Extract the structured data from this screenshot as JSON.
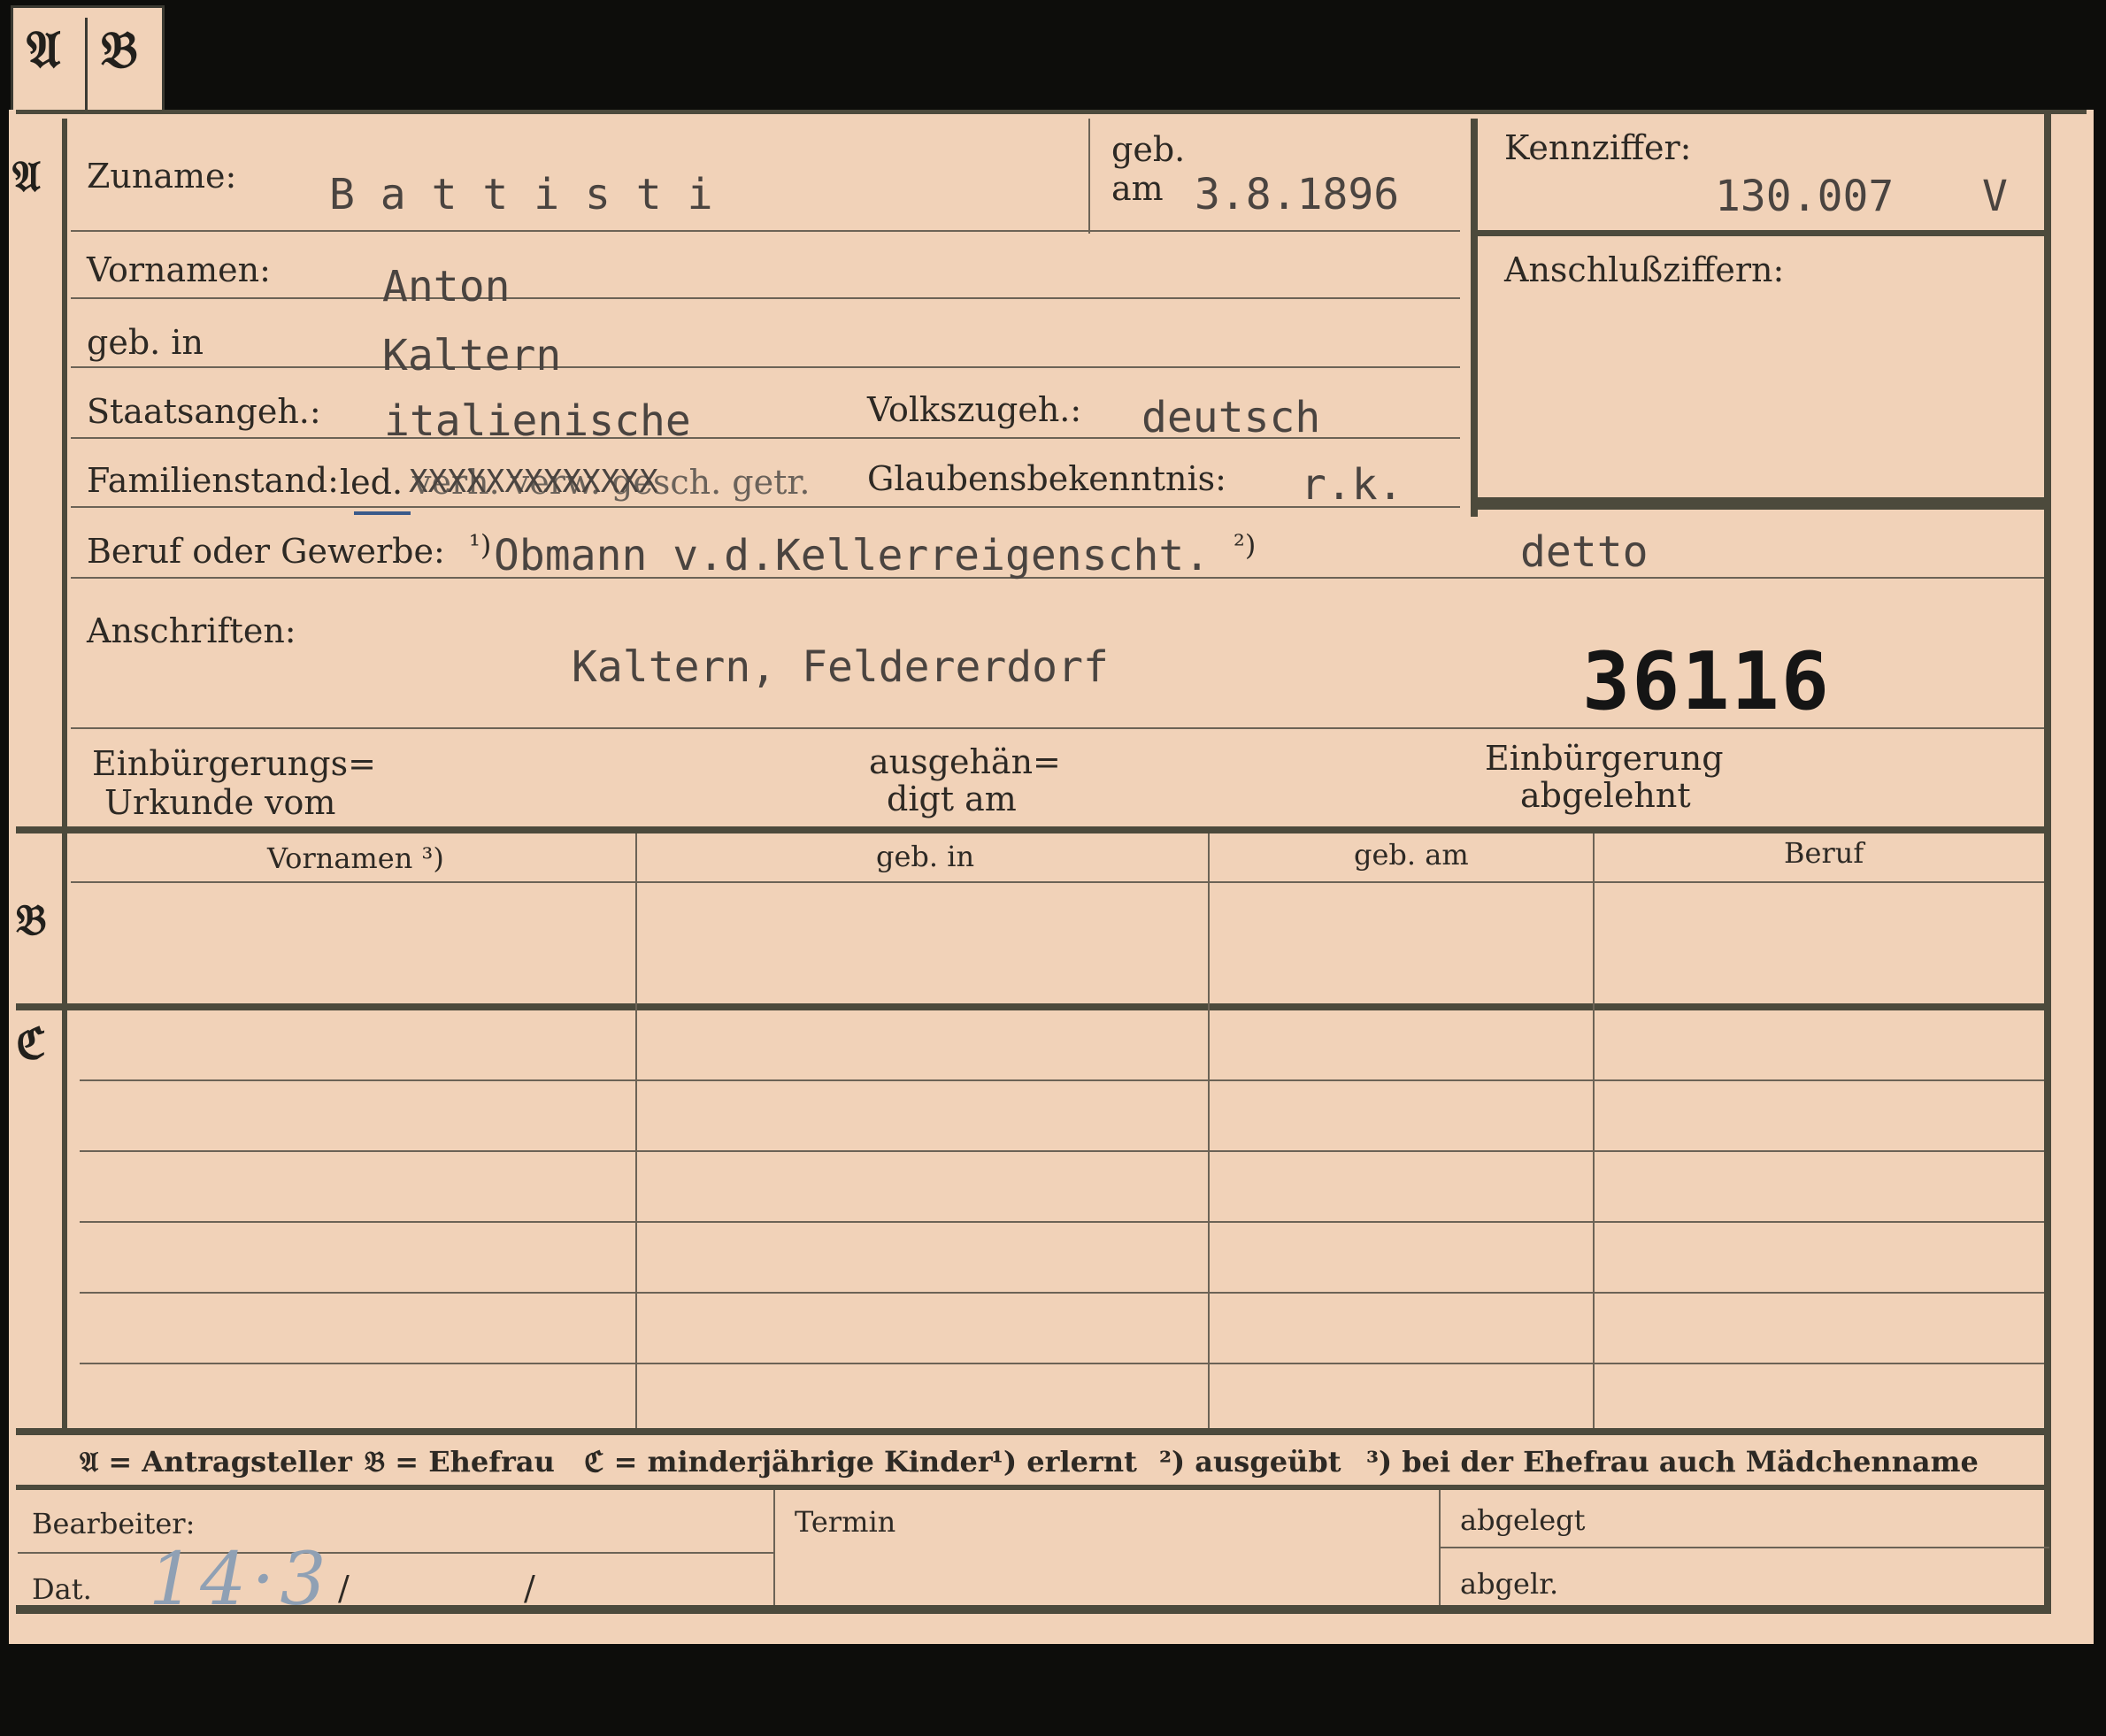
{
  "tab": {
    "letter_a": "𝔄",
    "letter_b": "𝔅"
  },
  "section_letters": {
    "a": "𝔄",
    "b": "𝔅",
    "c": "ℭ"
  },
  "labels": {
    "surname": "Zuname:",
    "born_on_1": "geb.",
    "born_on_2": "am",
    "reference_number": "Kennziffer:",
    "connection_numbers": "Anschlußziffern:",
    "first_names": "Vornamen:",
    "born_in": "geb. in",
    "citizenship": "Staatsangeh.:",
    "nationality": "Volkszugeh.:",
    "marital_status": "Familienstand:",
    "marital_options": "led.",
    "religion": "Glaubensbekenntnis:",
    "profession": "Beruf oder Gewerbe:",
    "profession_note1": "¹)",
    "addresses": "Anschriften:",
    "naturalization_doc_1": "Einbürgerungs=",
    "naturalization_doc_2": "Urkunde vom",
    "handed_out_1": "ausgehän=",
    "handed_out_2": "digt am",
    "naturalization_rejected_1": "Einbürgerung",
    "naturalization_rejected_2": "abgelehnt"
  },
  "values": {
    "surname": "B a t t i s t i",
    "birth_date": "3.8.1896",
    "reference_number": "130.007",
    "reference_suffix": "V",
    "first_names": "Anton",
    "birthplace": "Kaltern",
    "citizenship": "italienische",
    "nationality": "deutsch",
    "marital_struck": "verh. verw. gesch. getr.",
    "marital_strike_marks": "XXXXXXXXXXXXX",
    "religion": "r.k.",
    "profession_learned": "Obmann v.d.Kellerreigenscht.",
    "profession_note2": "²)",
    "profession_practiced": "detto",
    "address": "Kaltern, Feldererdorf",
    "stamp_number": "36116"
  },
  "table_headers": {
    "first_names": "Vornamen ³)",
    "born_in": "geb. in",
    "born_on": "geb. am",
    "profession": "Beruf"
  },
  "legend": {
    "a": "𝔄 = Antragsteller",
    "b": "𝔅 = Ehefrau",
    "c": "ℭ = minderjährige Kinder",
    "n1": "¹) erlernt",
    "n2": "²) ausgeübt",
    "n3": "³) bei der Ehefrau auch Mädchenname"
  },
  "footer": {
    "clerk": "Bearbeiter:",
    "date": "Dat.",
    "date_handwritten": "14·3",
    "slash1": "/",
    "slash2": "/",
    "deadline": "Termin",
    "filed": "abgelegt",
    "filed_short": "abgelr."
  }
}
